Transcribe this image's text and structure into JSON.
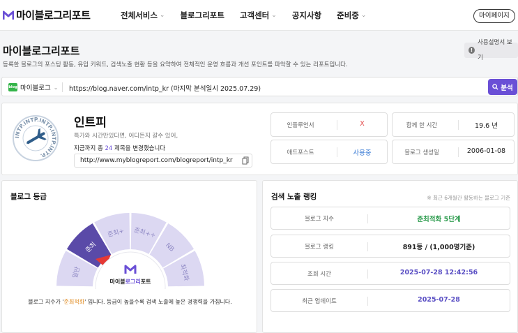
{
  "header": {
    "logo_text_1": "마이블로그",
    "logo_text_2": "리포트",
    "nav": [
      {
        "label": "전체서비스",
        "has_dropdown": true
      },
      {
        "label": "블로그리포트",
        "has_dropdown": false
      },
      {
        "label": "고객센터",
        "has_dropdown": true
      },
      {
        "label": "공지사항",
        "has_dropdown": false
      },
      {
        "label": "준비중",
        "has_dropdown": true
      }
    ],
    "mypage_label": "마이페이지"
  },
  "page": {
    "title": "마이블로그리포트",
    "description": "등록한 블로그의 포스팅 활동, 유입 키워드, 검색노출 현황 등을 요약하여 전체적인 운영 흐름과 개선 포인트를 파악할 수 있는 리포트입니다.",
    "guide_label": "사용설명서 보기"
  },
  "urlbar": {
    "platform": "마이블로그",
    "url": "https://blog.naver.com/intp_kr (마지막 분석일시 2025.07.29)",
    "analyze_label": "분석"
  },
  "profile": {
    "stamp_text": "INTP.INTP.INTP.INTP.INTP.",
    "name": "인트피",
    "subtitle": "특가와 시간만있다면, 어디든지 갈수 있어,",
    "title_change_prefix": "지금까지 총 ",
    "title_change_count": "24",
    "title_change_suffix": " 제목을 변경했습니다",
    "report_url": "http://www.myblogreport.com/blogreport/intp_kr",
    "stats": [
      {
        "label": "인플루언서",
        "value": "X"
      },
      {
        "label": "함께 한 시간",
        "value": "19.6 년"
      },
      {
        "label": "애드포스트",
        "value": "사용중"
      },
      {
        "label": "블로그 생성일",
        "value": "2006-01-08"
      }
    ]
  },
  "grade": {
    "title": "블로그 등급",
    "segments": [
      "일반",
      "준최",
      "준최+",
      "준최++",
      "NB",
      "최적화"
    ],
    "current_segment": "준최",
    "center_logo_1": "마이블",
    "center_logo_2": "로그리",
    "center_logo_3": "포트",
    "note_prefix": "블로그 지수가 '",
    "note_grade": "준최적화",
    "note_suffix": "' 입니다. 등급이 높을수록 검색 노출에 높은 경쟁력을 가집니다."
  },
  "ranking": {
    "title": "검색 노출 랭킹",
    "note": "※ 최근 6개월간 활동하는 블로그 기준",
    "rows": [
      {
        "label": "블로그 지수",
        "value": "준최적화 5단계"
      },
      {
        "label": "블로그 랭킹",
        "value": "891등 / (1,000명기준)"
      },
      {
        "label": "조회 시간",
        "value": "2025-07-28 12:42:56"
      },
      {
        "label": "최근 업데이트",
        "value": "2025-07-28"
      }
    ]
  },
  "colors": {
    "accent": "#6a4fd6",
    "gauge_active": "#5a4aa8",
    "gauge_inactive": "#dcd8f2",
    "pointer": "#e53935",
    "success": "#2e9c4f",
    "warning": "#e08a1e"
  }
}
